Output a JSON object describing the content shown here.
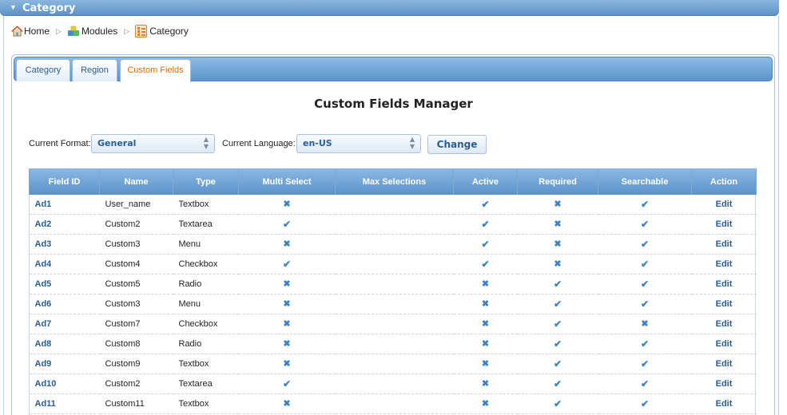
{
  "panel": {
    "title": "Category"
  },
  "breadcrumb": {
    "home": "Home",
    "modules": "Modules",
    "category": "Category"
  },
  "tabs": [
    {
      "label": "Category"
    },
    {
      "label": "Region"
    },
    {
      "label": "Custom Fields"
    }
  ],
  "page_title": "Custom Fields Manager",
  "form": {
    "format_label": "Current Format:",
    "format_value": "General",
    "language_label": "Current Language:",
    "language_value": "en-US",
    "change_label": "Change"
  },
  "table": {
    "headers": [
      "Field ID",
      "Name",
      "Type",
      "Multi Select",
      "Max Selections",
      "Active",
      "Required",
      "Searchable",
      "Action"
    ],
    "rows": [
      {
        "id": "Ad1",
        "name": "User_name",
        "type": "Textbox",
        "multi": false,
        "max": "",
        "active": true,
        "required": false,
        "searchable": true,
        "action": "Edit"
      },
      {
        "id": "Ad2",
        "name": "Custom2",
        "type": "Textarea",
        "multi": true,
        "max": "",
        "active": true,
        "required": false,
        "searchable": true,
        "action": "Edit"
      },
      {
        "id": "Ad3",
        "name": "Custom3",
        "type": "Menu",
        "multi": false,
        "max": "",
        "active": true,
        "required": false,
        "searchable": true,
        "action": "Edit"
      },
      {
        "id": "Ad4",
        "name": "Custom4",
        "type": "Checkbox",
        "multi": true,
        "max": "",
        "active": true,
        "required": false,
        "searchable": true,
        "action": "Edit"
      },
      {
        "id": "Ad5",
        "name": "Custom5",
        "type": "Radio",
        "multi": false,
        "max": "",
        "active": false,
        "required": true,
        "searchable": true,
        "action": "Edit"
      },
      {
        "id": "Ad6",
        "name": "Custom3",
        "type": "Menu",
        "multi": false,
        "max": "",
        "active": false,
        "required": true,
        "searchable": true,
        "action": "Edit"
      },
      {
        "id": "Ad7",
        "name": "Custom7",
        "type": "Checkbox",
        "multi": false,
        "max": "",
        "active": false,
        "required": true,
        "searchable": false,
        "action": "Edit"
      },
      {
        "id": "Ad8",
        "name": "Custom8",
        "type": "Radio",
        "multi": false,
        "max": "",
        "active": false,
        "required": true,
        "searchable": true,
        "action": "Edit"
      },
      {
        "id": "Ad9",
        "name": "Custom9",
        "type": "Textbox",
        "multi": false,
        "max": "",
        "active": false,
        "required": true,
        "searchable": true,
        "action": "Edit"
      },
      {
        "id": "Ad10",
        "name": "Custom2",
        "type": "Textarea",
        "multi": true,
        "max": "",
        "active": false,
        "required": true,
        "searchable": true,
        "action": "Edit"
      },
      {
        "id": "Ad11",
        "name": "Custom11",
        "type": "Textbox",
        "multi": false,
        "max": "",
        "active": false,
        "required": true,
        "searchable": true,
        "action": "Edit"
      }
    ]
  },
  "icons": {
    "check": "check-icon",
    "cross": "cross-icon"
  },
  "colors": {
    "accent": "#2a5d96",
    "active_tab": "#e46c0a",
    "header_blue": "#5a92c9",
    "mark_blue": "#3d82c4"
  }
}
